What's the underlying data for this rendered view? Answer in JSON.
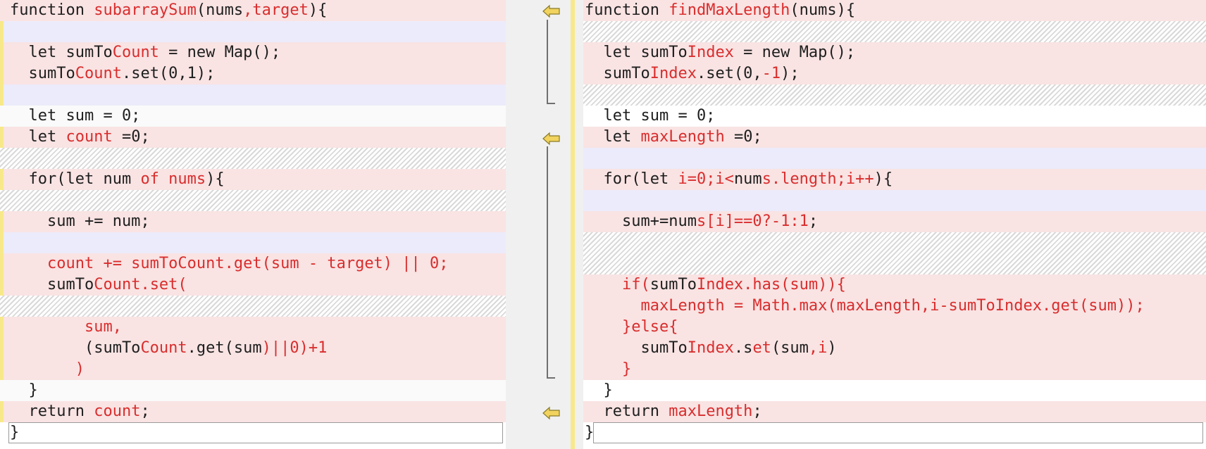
{
  "left": {
    "lines": [
      {
        "segs": [
          {
            "t": "function "
          },
          {
            "t": "subarraySum",
            "d": true
          },
          {
            "t": "(nums"
          },
          {
            "t": ",target",
            "d": true
          },
          {
            "t": "){"
          }
        ]
      },
      {
        "segs": [
          {
            "t": ""
          }
        ]
      },
      {
        "segs": [
          {
            "t": "  let sumTo"
          },
          {
            "t": "Count",
            "d": true
          },
          {
            "t": " = new Map();"
          }
        ]
      },
      {
        "segs": [
          {
            "t": "  sumTo"
          },
          {
            "t": "Count",
            "d": true
          },
          {
            "t": ".set(0,1);"
          }
        ]
      },
      {
        "segs": [
          {
            "t": ""
          }
        ]
      },
      {
        "segs": [
          {
            "t": "  let sum = 0;"
          }
        ]
      },
      {
        "segs": [
          {
            "t": "  let "
          },
          {
            "t": "count",
            "d": true
          },
          {
            "t": " =0;"
          }
        ]
      },
      {
        "segs": [
          {
            "t": ""
          }
        ]
      },
      {
        "segs": [
          {
            "t": "  for(let "
          },
          {
            "t": "num of nums",
            "dmix": true
          },
          {
            "t": "){"
          }
        ]
      },
      {
        "segs": [
          {
            "t": ""
          }
        ]
      },
      {
        "segs": [
          {
            "t": "    sum += num;"
          }
        ]
      },
      {
        "segs": [
          {
            "t": ""
          }
        ]
      },
      {
        "segs": [
          {
            "t": "    count += sumToCount.get(sum - target) || 0;",
            "d": true
          }
        ]
      },
      {
        "segs": [
          {
            "t": "    sumTo"
          },
          {
            "t": "Count.set(",
            "d": true
          }
        ]
      },
      {
        "segs": [
          {
            "t": ""
          }
        ]
      },
      {
        "segs": [
          {
            "t": "        sum,",
            "d": true
          }
        ]
      },
      {
        "segs": [
          {
            "t": "        (sumTo"
          },
          {
            "t": "Count",
            "d": true
          },
          {
            "t": ".get(sum"
          },
          {
            "t": ")||0)+1",
            "d": true
          }
        ]
      },
      {
        "segs": [
          {
            "t": "       )",
            "d": true
          }
        ]
      },
      {
        "segs": [
          {
            "t": "  }"
          }
        ]
      },
      {
        "segs": [
          {
            "t": "  return "
          },
          {
            "t": "count",
            "d": true
          },
          {
            "t": ";"
          }
        ]
      },
      {
        "segs": [
          {
            "t": "}"
          }
        ]
      }
    ]
  },
  "right": {
    "lines": [
      {
        "segs": [
          {
            "t": "function "
          },
          {
            "t": "findMaxLength",
            "d": true
          },
          {
            "t": "(nums){"
          }
        ]
      },
      {
        "segs": [
          {
            "t": ""
          }
        ]
      },
      {
        "segs": [
          {
            "t": "  let sumTo"
          },
          {
            "t": "Index",
            "d": true
          },
          {
            "t": " = new Map();"
          }
        ]
      },
      {
        "segs": [
          {
            "t": "  sumTo"
          },
          {
            "t": "Index",
            "d": true
          },
          {
            "t": ".set(0,"
          },
          {
            "t": "-1",
            "d": true
          },
          {
            "t": ");"
          }
        ]
      },
      {
        "segs": [
          {
            "t": ""
          }
        ]
      },
      {
        "segs": [
          {
            "t": "  let sum = 0;"
          }
        ]
      },
      {
        "segs": [
          {
            "t": "  let "
          },
          {
            "t": "maxLength",
            "d": true
          },
          {
            "t": " =0;"
          }
        ]
      },
      {
        "segs": [
          {
            "t": ""
          }
        ]
      },
      {
        "segs": [
          {
            "t": "  for(let "
          },
          {
            "t": "i=0;i<",
            "d": true
          },
          {
            "t": "num"
          },
          {
            "t": "s.length;i++",
            "d": true
          },
          {
            "t": "){"
          }
        ]
      },
      {
        "segs": [
          {
            "t": ""
          }
        ]
      },
      {
        "segs": [
          {
            "t": "    sum+=num"
          },
          {
            "t": "s[i]==0?-1:1",
            "d": true
          },
          {
            "t": ";"
          }
        ]
      },
      {
        "segs": [
          {
            "t": ""
          }
        ]
      },
      {
        "segs": [
          {
            "t": ""
          }
        ]
      },
      {
        "segs": [
          {
            "t": "    if(",
            "d": true
          },
          {
            "t": "sumTo"
          },
          {
            "t": "Index.has(sum)){",
            "d": true
          }
        ]
      },
      {
        "segs": [
          {
            "t": "      maxLength = Math.max(maxLength,i-sumToIndex.get(sum));",
            "d": true
          }
        ]
      },
      {
        "segs": [
          {
            "t": "    }else{",
            "d": true
          }
        ]
      },
      {
        "segs": [
          {
            "t": "      sumTo"
          },
          {
            "t": "Index",
            "d": true
          },
          {
            "t": ".s"
          },
          {
            "t": "et",
            "d": true
          },
          {
            "t": "(sum"
          },
          {
            "t": ",i",
            "d": true
          },
          {
            "t": ")"
          }
        ]
      },
      {
        "segs": [
          {
            "t": "    }",
            "d": true
          }
        ]
      },
      {
        "segs": [
          {
            "t": "  }"
          }
        ]
      },
      {
        "segs": [
          {
            "t": "  return "
          },
          {
            "t": "maxLength",
            "d": true
          },
          {
            "t": ";"
          }
        ]
      },
      {
        "segs": [
          {
            "t": "}"
          }
        ]
      }
    ]
  },
  "colors": {
    "changed": "#f9e3e3",
    "blank": "#ecebfb",
    "deleted_text": "#d92d2d",
    "marker": "#f7e98a"
  }
}
